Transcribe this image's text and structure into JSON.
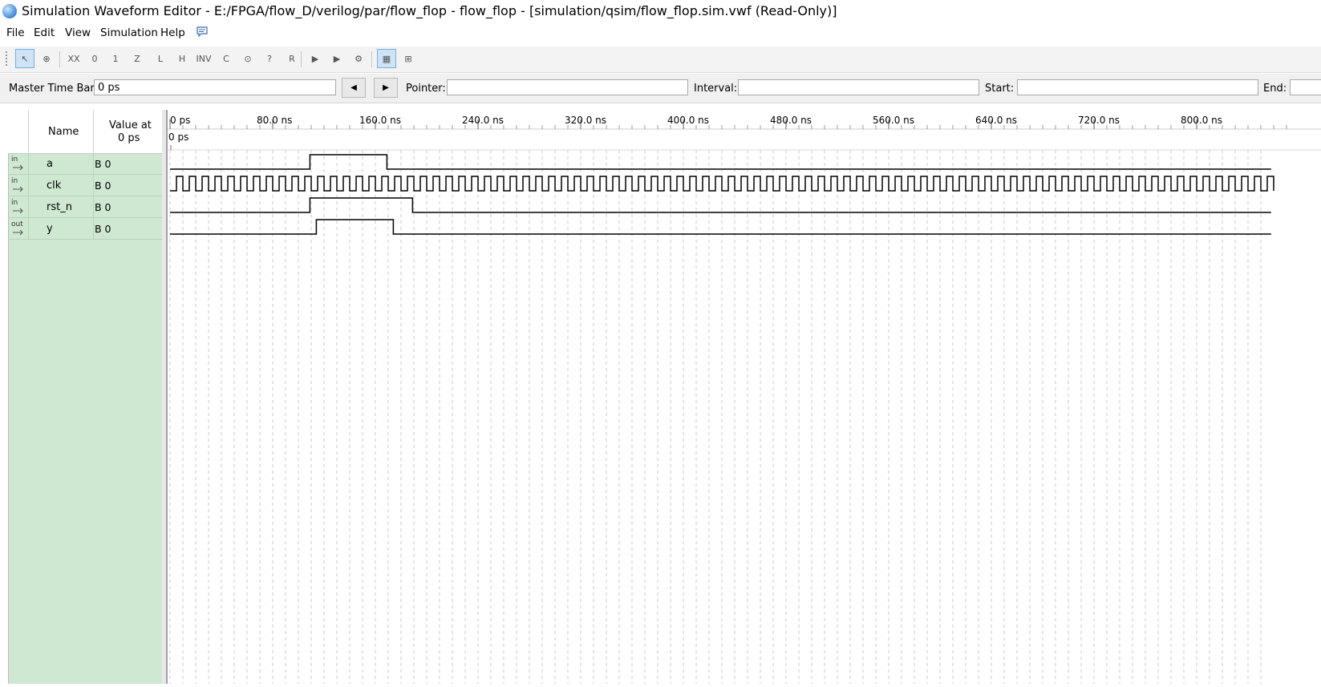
{
  "window": {
    "title": "Simulation Waveform Editor - E:/FPGA/flow_D/verilog/par/flow_flop - flow_flop - [simulation/qsim/flow_flop.sim.vwf (Read-Only)]"
  },
  "menu": {
    "items": [
      {
        "label": "File"
      },
      {
        "label": "Edit"
      },
      {
        "label": "View"
      },
      {
        "label": "Simulation"
      },
      {
        "label": "Help"
      }
    ]
  },
  "toolbar": {
    "buttons": [
      {
        "icon": "selection-tool-icon",
        "glyph": "↖",
        "active": true
      },
      {
        "icon": "zoom-tool-icon",
        "glyph": "⊕",
        "active": false
      },
      {
        "icon": "forcing-unknown-icon",
        "glyph": "XX",
        "active": false
      },
      {
        "icon": "forcing-low-icon",
        "glyph": "0",
        "active": false
      },
      {
        "icon": "forcing-high-icon",
        "glyph": "1",
        "active": false
      },
      {
        "icon": "high-impedance-icon",
        "glyph": "Z",
        "active": false
      },
      {
        "icon": "weak-low-icon",
        "glyph": "L",
        "active": false
      },
      {
        "icon": "weak-high-icon",
        "glyph": "H",
        "active": false
      },
      {
        "icon": "invert-icon",
        "glyph": "INV",
        "active": false
      },
      {
        "icon": "count-value-icon",
        "glyph": "C",
        "active": false
      },
      {
        "icon": "overwrite-clock-icon",
        "glyph": "⊙",
        "active": false
      },
      {
        "icon": "arbitrary-value-icon",
        "glyph": "?",
        "active": false
      },
      {
        "icon": "random-value-icon",
        "glyph": "R",
        "active": false
      },
      {
        "icon": "run-functional-simulation-icon",
        "glyph": "▶",
        "active": false
      },
      {
        "icon": "run-timing-simulation-icon",
        "glyph": "▶",
        "active": false
      },
      {
        "icon": "generate-netlist-icon",
        "glyph": "⚙",
        "active": false
      },
      {
        "icon": "snap-to-grid-icon",
        "glyph": "▦",
        "active": true
      },
      {
        "icon": "group-icon",
        "glyph": "⊞",
        "active": false
      }
    ]
  },
  "timebar": {
    "master_label": "Master Time Bar:",
    "master_value": "0 ps",
    "pointer_label": "Pointer:",
    "pointer_value": "",
    "interval_label": "Interval:",
    "interval_value": "",
    "start_label": "Start:",
    "start_value": "",
    "end_label": "End:",
    "end_value": ""
  },
  "signal_table": {
    "name_header": "Name",
    "value_header_line1": "Value at",
    "value_header_line2": "0 ps",
    "signals": [
      {
        "direction": "in",
        "name": "a",
        "value": "B 0"
      },
      {
        "direction": "in",
        "name": "clk",
        "value": "B 0"
      },
      {
        "direction": "in",
        "name": "rst_n",
        "value": "B 0"
      },
      {
        "direction": "out",
        "name": "y",
        "value": "B 0"
      }
    ]
  },
  "waveform": {
    "time_ruler": [
      "0 ps",
      "80.0 ns",
      "160.0 ns",
      "240.0 ns",
      "320.0 ns",
      "400.0 ns",
      "480.0 ns",
      "560.0 ns",
      "640.0 ns",
      "720.0 ns",
      "800.0 ns"
    ],
    "cursor_label": "0 ps",
    "time_unit": "ns",
    "visible_range_ns": [
      0,
      858
    ],
    "clock_period_ns": 10,
    "traces": {
      "a": [
        [
          0,
          0
        ],
        [
          109,
          1
        ],
        [
          169,
          0
        ]
      ],
      "rst_n": [
        [
          0,
          0
        ],
        [
          109,
          1
        ],
        [
          189,
          0
        ]
      ],
      "y": [
        [
          0,
          0
        ],
        [
          114,
          1
        ],
        [
          174,
          0
        ]
      ]
    }
  }
}
